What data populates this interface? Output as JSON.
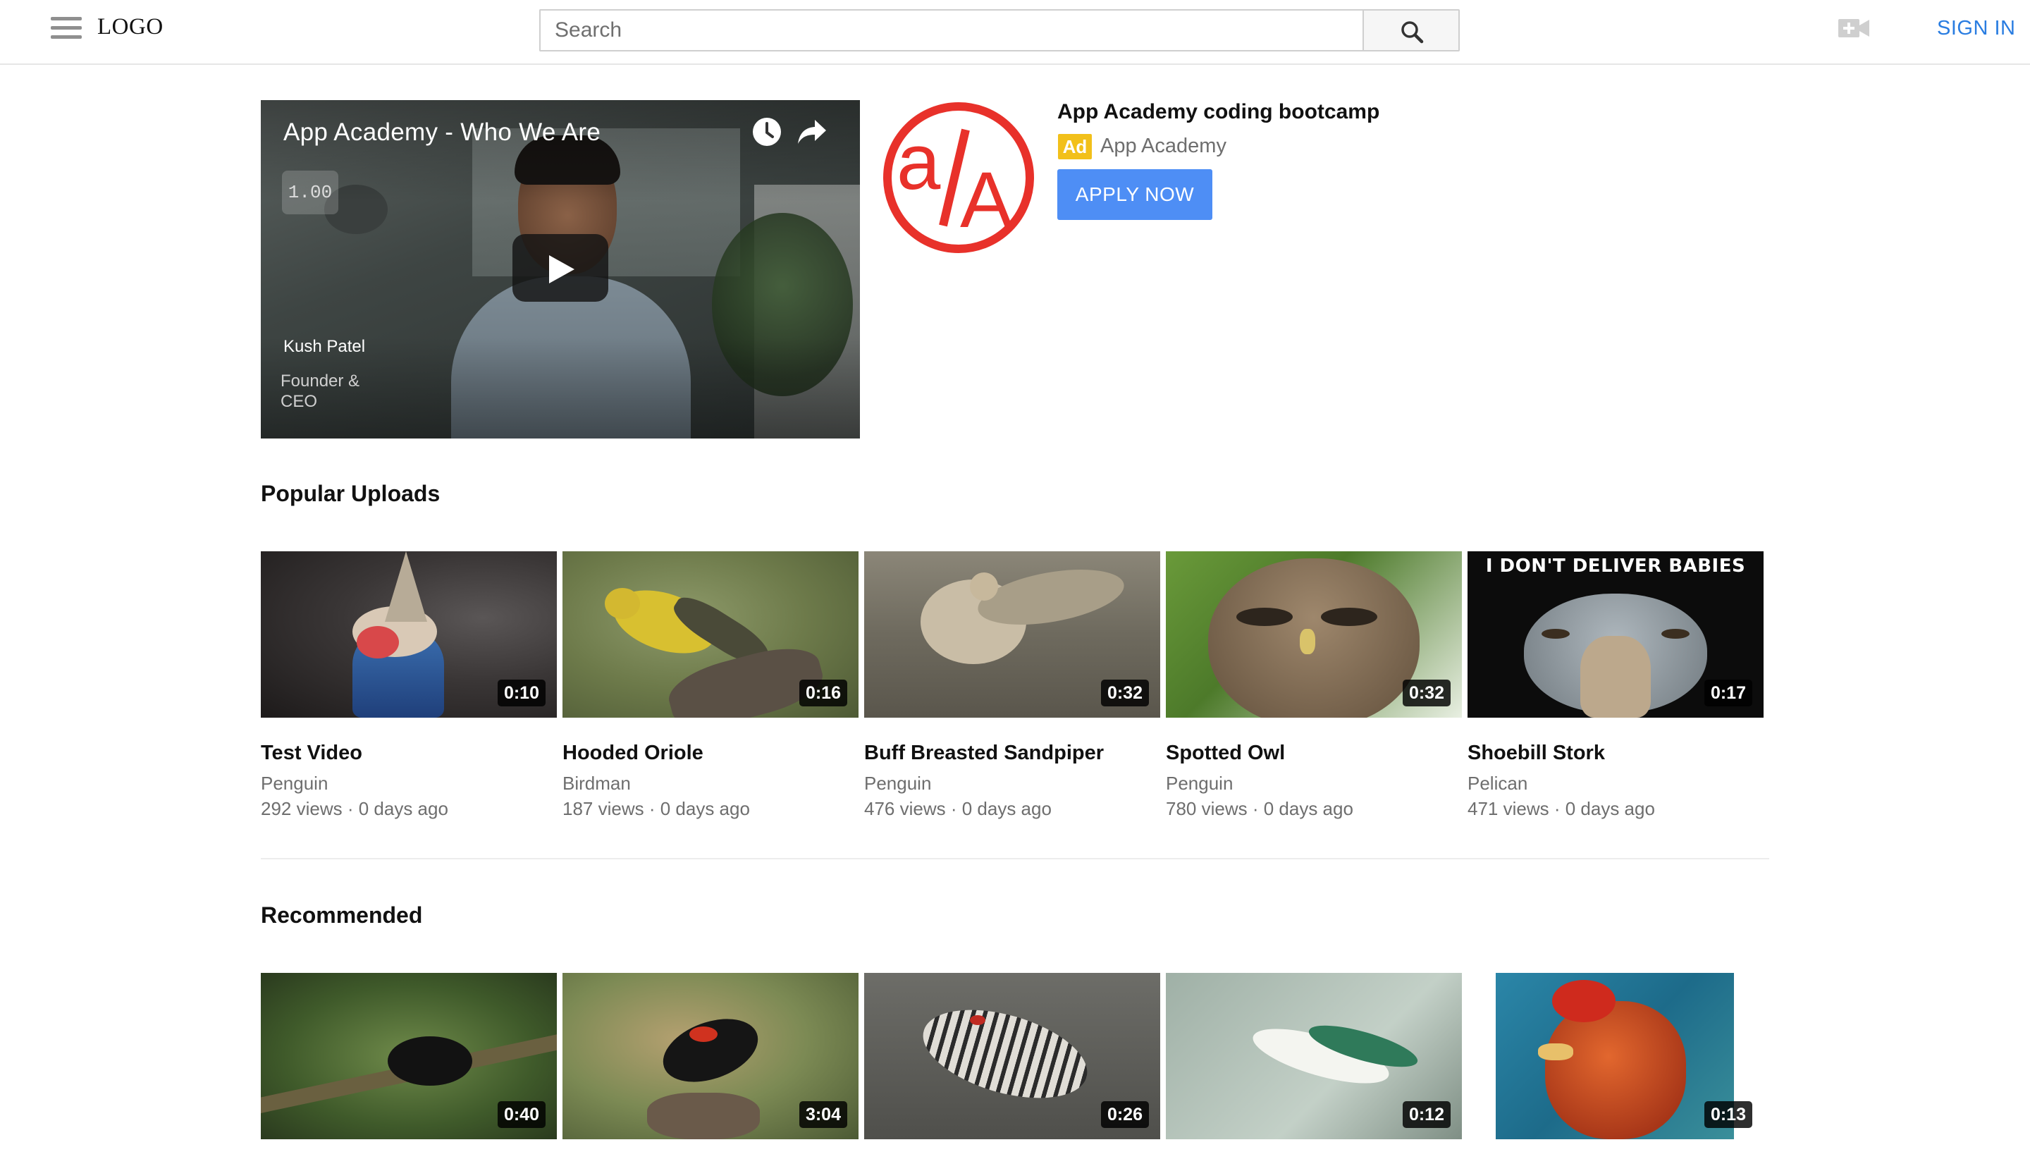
{
  "header": {
    "logo": "LOGO",
    "search_placeholder": "Search",
    "sign_in": "SIGN IN"
  },
  "featured": {
    "title": "App Academy - Who We Are",
    "speed": "1.00",
    "lower_third_name": "Kush Patel",
    "lower_third_role": "Founder & CEO"
  },
  "ad": {
    "title": "App Academy coding bootcamp",
    "badge": "Ad",
    "advertiser": "App Academy",
    "cta": "APPLY NOW",
    "brand_color": "#e8312a",
    "button_color": "#4e8ef5"
  },
  "popular": {
    "heading": "Popular Uploads",
    "videos": [
      {
        "title": "Test Video",
        "channel": "Penguin",
        "meta": "292 views · 0 days ago",
        "duration": "0:10"
      },
      {
        "title": "Hooded Oriole",
        "channel": "Birdman",
        "meta": "187 views · 0 days ago",
        "duration": "0:16"
      },
      {
        "title": "Buff Breasted Sandpiper",
        "channel": "Penguin",
        "meta": "476 views · 0 days ago",
        "duration": "0:32"
      },
      {
        "title": "Spotted Owl",
        "channel": "Penguin",
        "meta": "780 views · 0 days ago",
        "duration": "0:32"
      },
      {
        "title": "Shoebill Stork",
        "channel": "Pelican",
        "meta": "471 views · 0 days ago",
        "duration": "0:17",
        "caption": "I DON'T DELIVER BABIES"
      }
    ]
  },
  "recommended": {
    "heading": "Recommended",
    "videos": [
      {
        "duration": "0:40"
      },
      {
        "duration": "3:04"
      },
      {
        "duration": "0:26"
      },
      {
        "duration": "0:12"
      },
      {
        "duration": "0:13"
      }
    ]
  }
}
